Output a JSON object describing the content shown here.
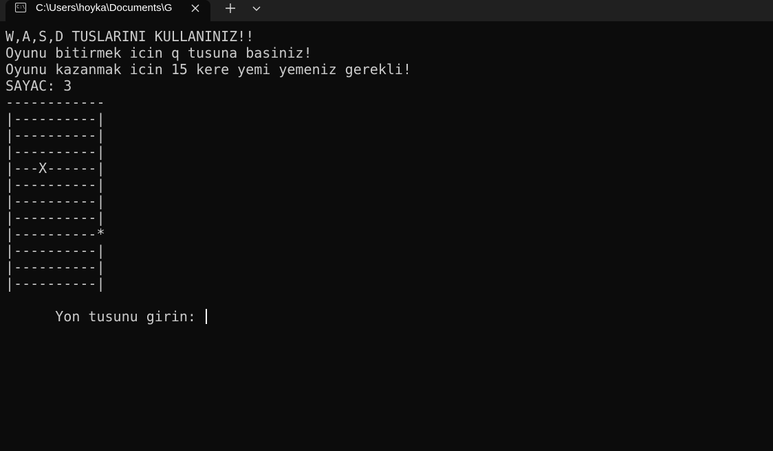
{
  "tab": {
    "icon": "terminal-icon",
    "icon_glyph": "C:\\",
    "title": "C:\\Users\\hoyka\\Documents\\G"
  },
  "toolbar": {
    "close_icon": "close-icon",
    "new_tab_icon": "plus-icon",
    "dropdown_icon": "chevron-down-icon"
  },
  "terminal": {
    "lines": [
      "W,A,S,D TUSLARINI KULLANINIZ!!",
      "Oyunu bitirmek icin q tusuna basiniz!",
      "Oyunu kazanmak icin 15 kere yemi yemeniz gerekli!",
      "SAYAC: 3",
      "------------",
      "|----------|",
      "|----------|",
      "|----------|",
      "|---X------|",
      "|----------|",
      "|----------|",
      "|----------|",
      "|----------*",
      "|----------|",
      "|----------|",
      "|----------|"
    ],
    "prompt": "Yon tusunu girin: "
  },
  "colors": {
    "background": "#0c0c0c",
    "tabbar": "#202020",
    "text": "#cccccc",
    "cursor": "#ffffff"
  }
}
